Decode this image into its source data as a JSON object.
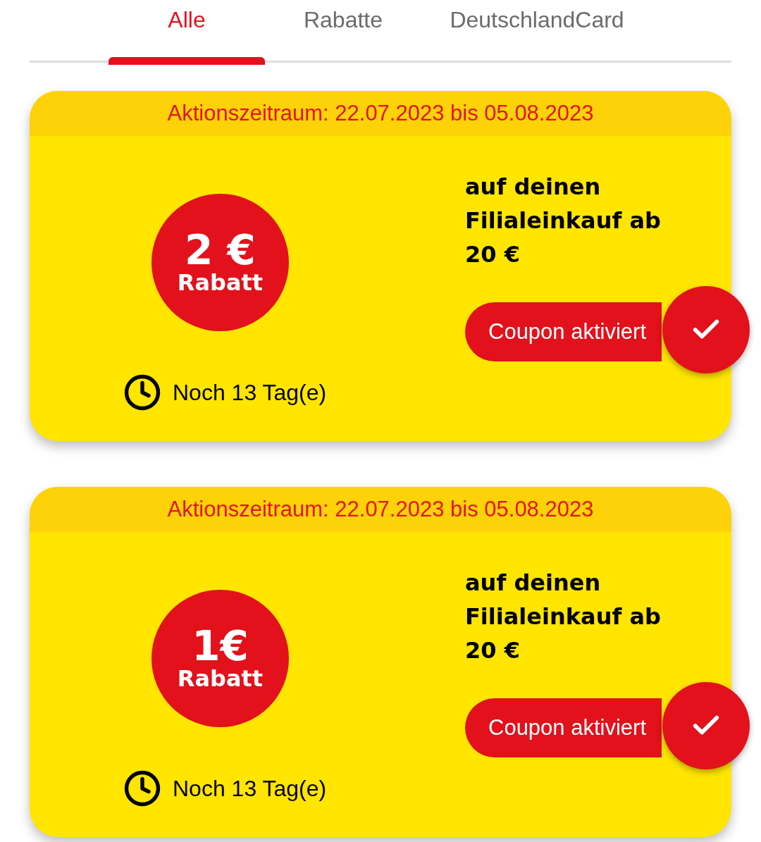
{
  "tabs": [
    {
      "label": "Alle",
      "selected": true
    },
    {
      "label": "Rabatte",
      "selected": false
    },
    {
      "label": "DeutschlandCard",
      "selected": false
    }
  ],
  "coupons": [
    {
      "period": "Aktionszeitraum: 22.07.2023 bis 05.08.2023",
      "badge_amount": "2 €",
      "badge_label": "Rabatt",
      "description": "auf deinen Filialeinkauf ab 20 €",
      "button": "Coupon aktiviert",
      "activated": true,
      "remaining": "Noch 13 Tag(e)"
    },
    {
      "period": "Aktionszeitraum: 22.07.2023 bis 05.08.2023",
      "badge_amount": "1€",
      "badge_label": "Rabatt",
      "description": "auf deinen Filialeinkauf ab 20 €",
      "button": "Coupon aktiviert",
      "activated": true,
      "remaining": "Noch 13 Tag(e)"
    }
  ]
}
